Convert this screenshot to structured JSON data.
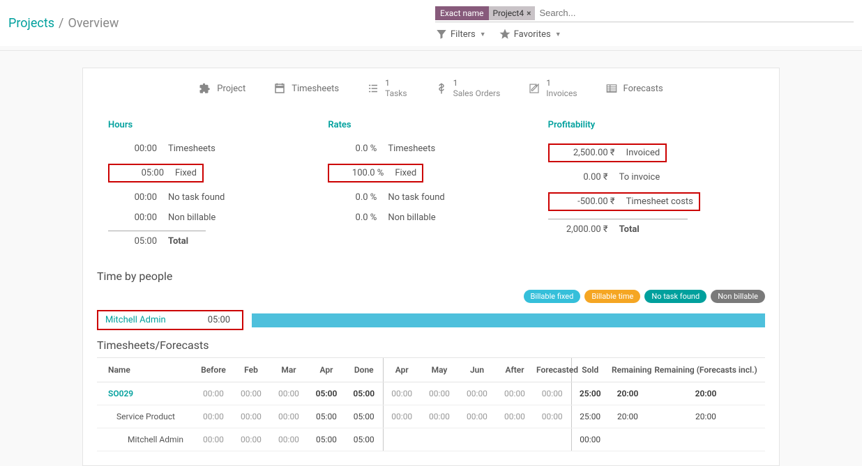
{
  "breadcrumb": {
    "root": "Projects",
    "sep": "/",
    "current": "Overview"
  },
  "search": {
    "chip_label": "Exact name",
    "chip_value": "Project4",
    "close": "×",
    "placeholder": "Search...",
    "filters": "Filters",
    "favorites": "Favorites"
  },
  "nav": {
    "project": "Project",
    "timesheets": "Timesheets",
    "tasks_n": "1",
    "tasks": "Tasks",
    "sales_n": "1",
    "sales": "Sales Orders",
    "inv_n": "1",
    "inv": "Invoices",
    "forecasts": "Forecasts"
  },
  "hours": {
    "title": "Hours",
    "ts_v": "00:00",
    "ts_l": "Timesheets",
    "fx_v": "05:00",
    "fx_l": "Fixed",
    "nt_v": "00:00",
    "nt_l": "No task found",
    "nb_v": "00:00",
    "nb_l": "Non billable",
    "tot_v": "05:00",
    "tot_l": "Total"
  },
  "rates": {
    "title": "Rates",
    "ts_v": "0.0 %",
    "ts_l": "Timesheets",
    "fx_v": "100.0 %",
    "fx_l": "Fixed",
    "nt_v": "0.0 %",
    "nt_l": "No task found",
    "nb_v": "0.0 %",
    "nb_l": "Non billable"
  },
  "profit": {
    "title": "Profitability",
    "inv_v": "2,500.00 ₹",
    "inv_l": "Invoiced",
    "toinv_v": "0.00 ₹",
    "toinv_l": "To invoice",
    "tc_v": "-500.00 ₹",
    "tc_l": "Timesheet costs",
    "tot_v": "2,000.00 ₹",
    "tot_l": "Total"
  },
  "people": {
    "title": "Time by people",
    "badges": {
      "bf": "Billable fixed",
      "bt": "Billable time",
      "nt": "No task found",
      "nb": "Non billable"
    },
    "name": "Mitchell Admin",
    "hours": "05:00"
  },
  "tsf": {
    "title": "Timesheets/Forecasts",
    "head": {
      "name": "Name",
      "before": "Before",
      "feb": "Feb",
      "mar": "Mar",
      "apr": "Apr",
      "done": "Done",
      "apr2": "Apr",
      "may": "May",
      "jun": "Jun",
      "after": "After",
      "forecasted": "Forecasted",
      "sold": "Sold",
      "remaining": "Remaining",
      "remaining_f": "Remaining (Forecasts incl.)"
    },
    "rows": [
      {
        "name": "SO029",
        "link": true,
        "indent": 0,
        "before": "00:00",
        "feb": "00:00",
        "mar": "00:00",
        "apr": "05:00",
        "done": "05:00",
        "apr2": "00:00",
        "may": "00:00",
        "jun": "00:00",
        "after": "00:00",
        "forecasted": "00:00",
        "sold": "25:00",
        "remaining": "20:00",
        "remaining_f": "20:00"
      },
      {
        "name": "Service Product",
        "link": false,
        "indent": 1,
        "before": "00:00",
        "feb": "00:00",
        "mar": "00:00",
        "apr": "05:00",
        "done": "05:00",
        "apr2": "00:00",
        "may": "00:00",
        "jun": "00:00",
        "after": "00:00",
        "forecasted": "00:00",
        "sold": "25:00",
        "remaining": "20:00",
        "remaining_f": "20:00"
      },
      {
        "name": "Mitchell Admin",
        "link": false,
        "indent": 2,
        "before": "00:00",
        "feb": "00:00",
        "mar": "00:00",
        "apr": "05:00",
        "done": "05:00",
        "apr2": "",
        "may": "",
        "jun": "",
        "after": "",
        "forecasted": "",
        "sold": "00:00",
        "remaining": "",
        "remaining_f": ""
      }
    ]
  }
}
